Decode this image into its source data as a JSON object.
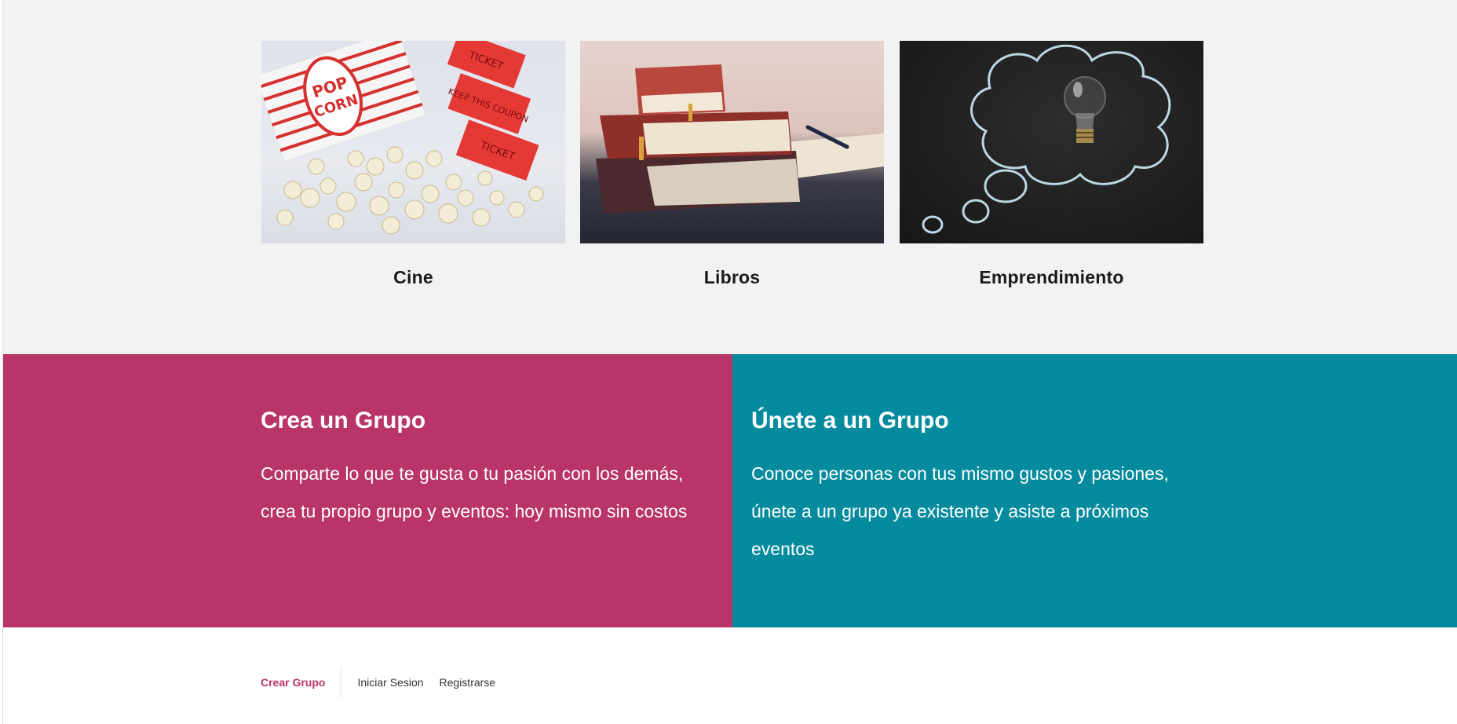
{
  "categories": [
    {
      "title": "Cine",
      "image": "popcorn-tickets-image"
    },
    {
      "title": "Libros",
      "image": "stacked-books-image"
    },
    {
      "title": "Emprendimiento",
      "image": "lightbulb-chalkboard-image"
    }
  ],
  "create_group": {
    "heading": "Crea un Grupo",
    "text": "Comparte lo que te gusta o tu pasión con los demás, crea tu propio grupo y eventos: hoy mismo sin costos"
  },
  "join_group": {
    "heading": "Únete a un Grupo",
    "text": "Conoce personas con tus mismo gustos y pasiones, únete a un grupo ya existente y asiste a próximos eventos"
  },
  "footer": {
    "create_group": "Crear Grupo",
    "login": "Iniciar Sesion",
    "register": "Registrarse"
  },
  "colors": {
    "accent_magenta": "#b83469",
    "accent_teal": "#068b9e",
    "background_light": "#f2f2f2"
  }
}
